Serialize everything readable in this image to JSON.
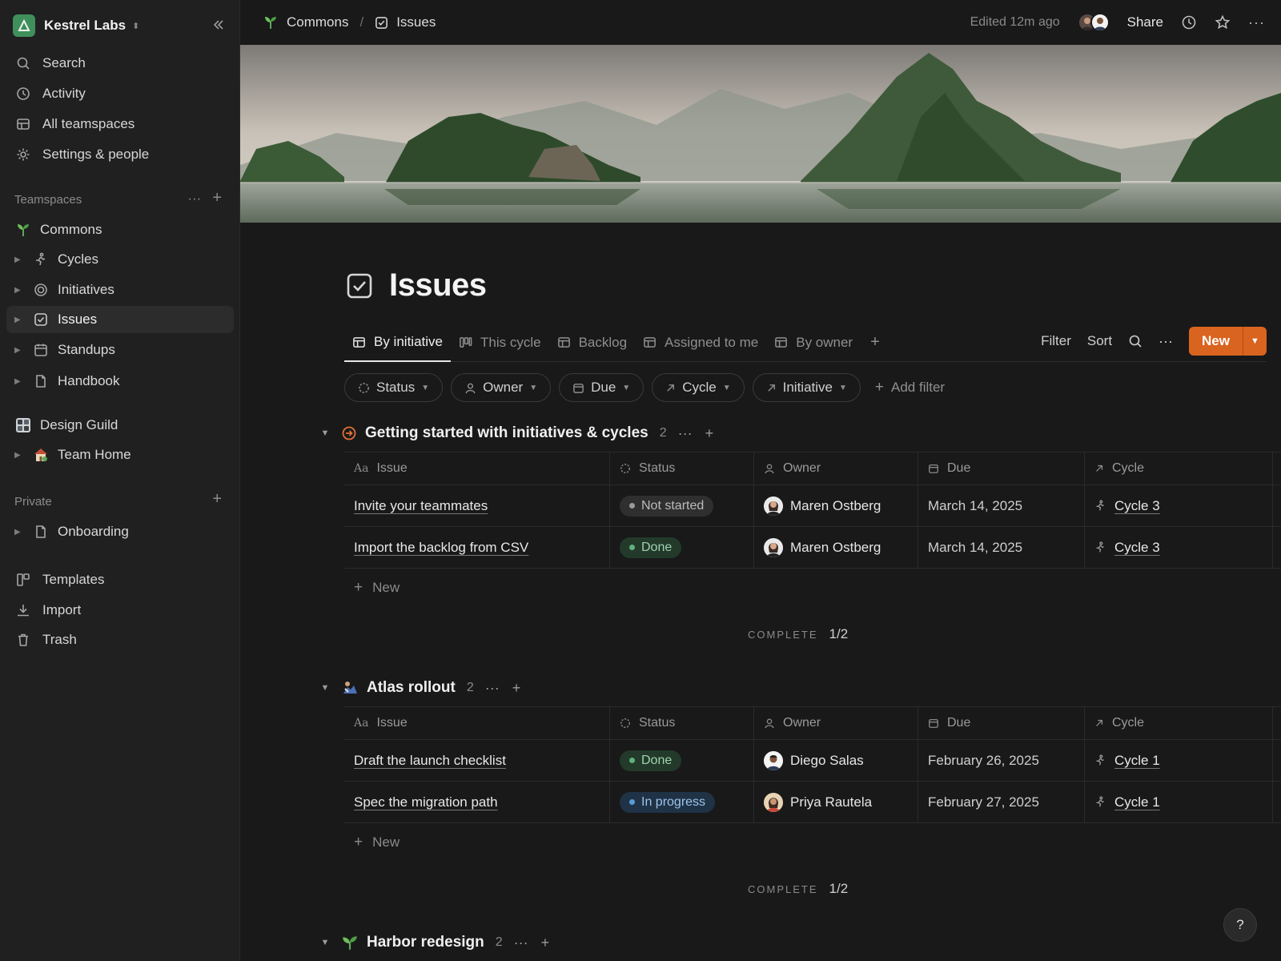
{
  "workspace": {
    "name": "Kestrel Labs"
  },
  "sidebar": {
    "nav": [
      {
        "label": "Search",
        "icon": "search-icon"
      },
      {
        "label": "Activity",
        "icon": "clock-icon"
      },
      {
        "label": "All teamspaces",
        "icon": "grid-icon"
      },
      {
        "label": "Settings & people",
        "icon": "gear-icon"
      }
    ],
    "teamspaces_title": "Teamspaces",
    "commons": "Commons",
    "commons_children": [
      {
        "label": "Cycles",
        "icon": "runner-icon"
      },
      {
        "label": "Initiatives",
        "icon": "target-icon"
      },
      {
        "label": "Issues",
        "icon": "checkbox-icon",
        "selected": true
      },
      {
        "label": "Standups",
        "icon": "calendar-icon"
      },
      {
        "label": "Handbook",
        "icon": "document-icon"
      }
    ],
    "design_guild": "Design Guild",
    "team_home": "Team Home",
    "private_title": "Private",
    "onboarding": "Onboarding",
    "bottom": [
      {
        "label": "Templates",
        "icon": "templates-icon"
      },
      {
        "label": "Import",
        "icon": "download-icon"
      },
      {
        "label": "Trash",
        "icon": "trash-icon"
      }
    ]
  },
  "topbar": {
    "crumbs": [
      "Commons",
      "Issues"
    ],
    "crumb_sep": "/",
    "edited": "Edited 12m ago",
    "share": "Share"
  },
  "page": {
    "title": "Issues",
    "tabs": [
      "By initiative",
      "This cycle",
      "Backlog",
      "Assigned to me",
      "By owner"
    ],
    "actions": {
      "filter": "Filter",
      "sort": "Sort",
      "new": "New"
    },
    "filters": [
      "Status",
      "Owner",
      "Due",
      "Cycle",
      "Initiative"
    ],
    "add_filter": "Add filter"
  },
  "columns": [
    "Issue",
    "Status",
    "Owner",
    "Due",
    "Cycle"
  ],
  "new_row_label": "New",
  "complete_label": "COMPLETE",
  "groups": [
    {
      "title": "Getting started with initiatives & cycles",
      "count": "2",
      "rows": [
        {
          "issue": "Invite your teammates",
          "status": "Not started",
          "owner": "Maren Ostberg",
          "due": "March 14, 2025",
          "cycle": "Cycle 3"
        },
        {
          "issue": "Import the backlog from CSV",
          "status": "Done",
          "owner": "Maren Ostberg",
          "due": "March 14, 2025",
          "cycle": "Cycle 3"
        }
      ],
      "complete": "1/2"
    },
    {
      "title": "Atlas rollout",
      "count": "2",
      "rows": [
        {
          "issue": "Draft the launch checklist",
          "status": "Done",
          "owner": "Diego Salas",
          "due": "February 26, 2025",
          "cycle": "Cycle 1"
        },
        {
          "issue": "Spec the migration path",
          "status": "In progress",
          "owner": "Priya Rautela",
          "due": "February 27, 2025",
          "cycle": "Cycle 1"
        }
      ],
      "complete": "1/2"
    },
    {
      "title": "Harbor redesign",
      "count": "2"
    }
  ],
  "help": "?",
  "colors": {
    "accent": "#d9641f",
    "done": "#5fb07a",
    "in_progress": "#5a9bd8",
    "background": "#191919"
  }
}
